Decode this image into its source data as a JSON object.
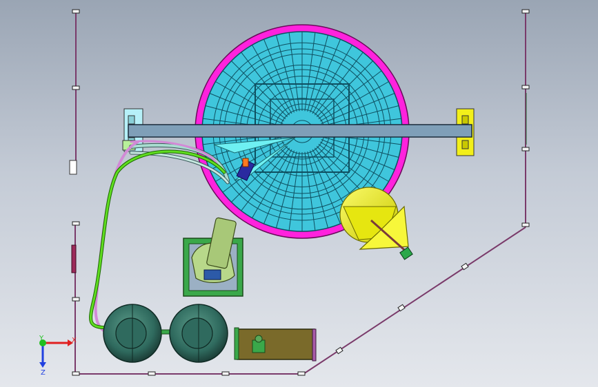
{
  "viewport": {
    "background_top": "#9aa5b4",
    "background_bottom": "#e4e7ec"
  },
  "triad": {
    "x_label": "X",
    "y_label": "Y",
    "z_label": "Z",
    "x_color": "#e02020",
    "y_color": "#20c020",
    "z_color": "#2040e0"
  },
  "colors": {
    "dish_rim": "#ff22dd",
    "dish_fill": "#3fc6dc",
    "dish_grid": "#0e4f60",
    "beam": "#7f9fb8",
    "beam_bracket_left": "#b6f0f8",
    "beam_bracket_right": "#f2ef1a",
    "cone": "#f2f21a",
    "tank": "#2f6a5e",
    "motor_base": "#3aa84a",
    "box": "#7a6a2a",
    "pipe_green": "#60dd20",
    "pipe_pink": "#d28ad6",
    "frame_line": "#7a3a6a"
  }
}
